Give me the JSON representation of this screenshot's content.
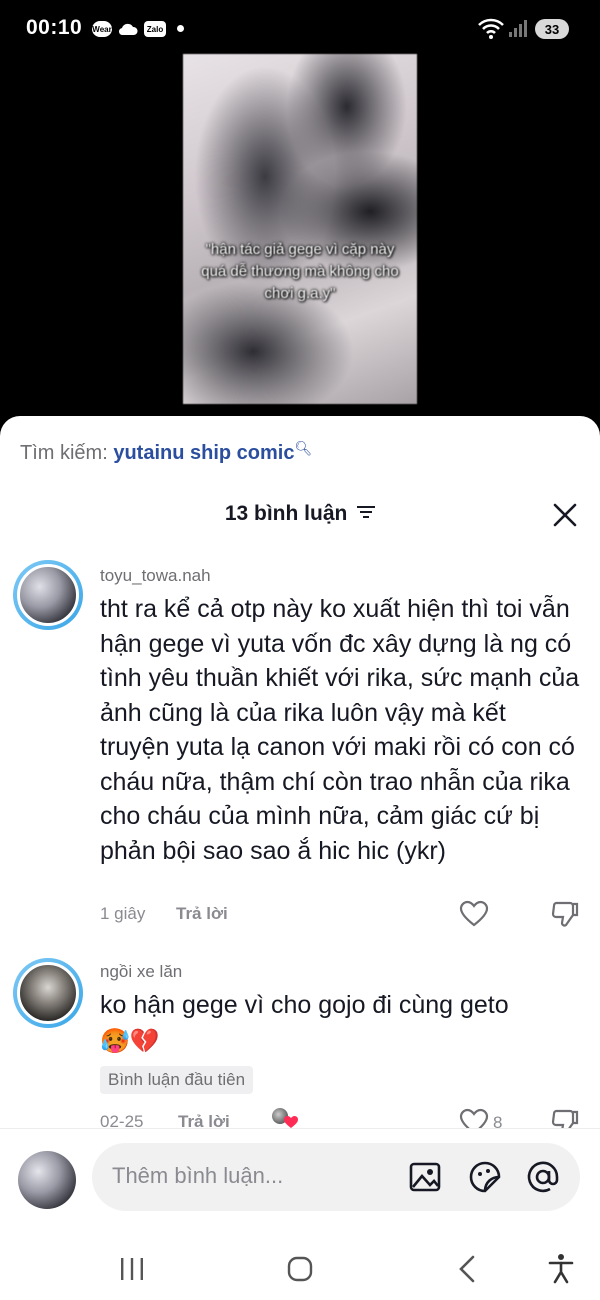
{
  "status_bar": {
    "time": "00:10",
    "icons": [
      "wear-icon",
      "cloud-icon",
      "zalo-icon"
    ],
    "wear_label": "Wear",
    "zalo_label": "Zalo",
    "battery": "33"
  },
  "video": {
    "caption": "\"hận tác giả gege vì cặp này quá dễ thương mà không cho chơi g.a.y\""
  },
  "search": {
    "prefix": "Tìm kiếm:",
    "term": "yutainu ship comic"
  },
  "comments_header": {
    "title": "13 bình luận"
  },
  "comments": [
    {
      "username": "toyu_towa.nah",
      "text": "tht ra kể cả otp này ko xuất hiện thì toi vẫn hận gege vì yuta vốn đc xây dựng là ng có tình yêu thuần khiết với rika, sức mạnh của ảnh cũng là của rika luôn vậy mà kết truyện yuta lạ canon với maki rồi có con có cháu nữa, thậm chí còn trao nhẫn của rika cho cháu của mình nữa, cảm giác cứ bị phản bội sao sao ắ hic hic (ykr)",
      "time": "1 giây",
      "reply_label": "Trả lời"
    },
    {
      "username": "ngồi xe lăn",
      "text": "ko hận gege vì cho gojo đi cùng geto",
      "emojis": "🥵💔",
      "badge": "Bình luận đầu tiên",
      "time": "02-25",
      "reply_label": "Trả lời",
      "like_count": "8"
    }
  ],
  "input": {
    "placeholder": "Thêm bình luận..."
  },
  "colors": {
    "accent": "#2b4f9e",
    "avatar_ring": "#3aa7e8",
    "text_primary": "#161823",
    "text_secondary": "#8a8b91"
  }
}
